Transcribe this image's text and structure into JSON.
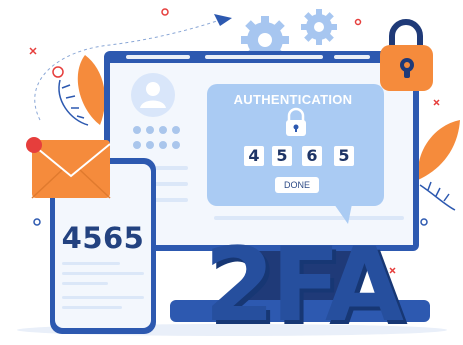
{
  "auth_card": {
    "title": "AUTHENTICATION",
    "digits": [
      "4",
      "5",
      "6",
      "5"
    ],
    "done_label": "DONE"
  },
  "phone": {
    "code": "4565"
  },
  "headline": "2FA",
  "colors": {
    "primary_blue": "#2d59b0",
    "dark_blue": "#1f3566",
    "light_blue": "#aacbf3",
    "orange": "#f58b3c",
    "red_badge": "#e63e3c",
    "screen_bg": "#f3f7fd"
  },
  "icons": [
    "padlock-icon",
    "lock-icon",
    "gear-icon",
    "envelope-icon",
    "user-avatar-icon",
    "paper-plane-icon"
  ]
}
